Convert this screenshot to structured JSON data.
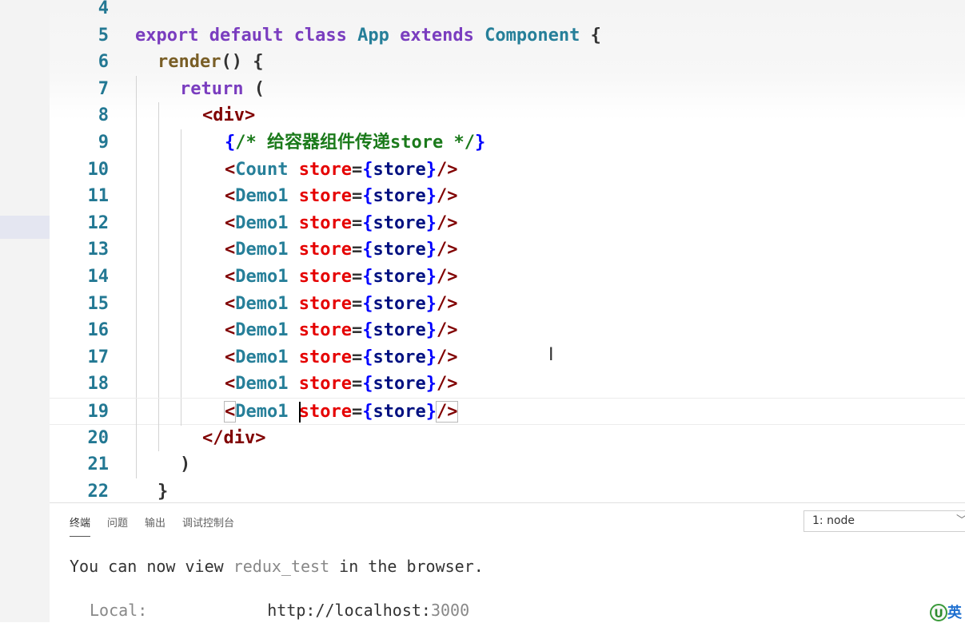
{
  "editor": {
    "lines": [
      {
        "n": "4",
        "tokens": []
      },
      {
        "n": "5",
        "tokens": [
          [
            "kw",
            "export "
          ],
          [
            "kw",
            "default "
          ],
          [
            "kw",
            "class "
          ],
          [
            "ty",
            "App "
          ],
          [
            "kw",
            "extends "
          ],
          [
            "ty",
            "Component "
          ],
          [
            "pl",
            "{"
          ]
        ]
      },
      {
        "n": "6",
        "tokens": [
          [
            "fn",
            "render"
          ],
          [
            "pl",
            "() {"
          ]
        ]
      },
      {
        "n": "7",
        "tokens": [
          [
            "kw",
            "return "
          ],
          [
            "pl",
            "("
          ]
        ]
      },
      {
        "n": "8",
        "tokens": [
          [
            "tag",
            "<div>"
          ]
        ]
      },
      {
        "n": "9",
        "tokens": [
          [
            "brace",
            "{"
          ],
          [
            "cm",
            "/* 给容器组件传递store */"
          ],
          [
            "brace",
            "}"
          ]
        ]
      },
      {
        "n": "10",
        "tokens": [
          [
            "tag",
            "<"
          ],
          [
            "cmp",
            "Count "
          ],
          [
            "attr",
            "store"
          ],
          [
            "pl",
            "="
          ],
          [
            "brace",
            "{"
          ],
          [
            "var",
            "store"
          ],
          [
            "brace",
            "}"
          ],
          [
            "tag",
            "/>"
          ]
        ]
      },
      {
        "n": "11",
        "tokens": [
          [
            "tag",
            "<"
          ],
          [
            "cmp",
            "Demo1 "
          ],
          [
            "attr",
            "store"
          ],
          [
            "pl",
            "="
          ],
          [
            "brace",
            "{"
          ],
          [
            "var",
            "store"
          ],
          [
            "brace",
            "}"
          ],
          [
            "tag",
            "/>"
          ]
        ]
      },
      {
        "n": "12",
        "tokens": [
          [
            "tag",
            "<"
          ],
          [
            "cmp",
            "Demo1 "
          ],
          [
            "attr",
            "store"
          ],
          [
            "pl",
            "="
          ],
          [
            "brace",
            "{"
          ],
          [
            "var",
            "store"
          ],
          [
            "brace",
            "}"
          ],
          [
            "tag",
            "/>"
          ]
        ]
      },
      {
        "n": "13",
        "tokens": [
          [
            "tag",
            "<"
          ],
          [
            "cmp",
            "Demo1 "
          ],
          [
            "attr",
            "store"
          ],
          [
            "pl",
            "="
          ],
          [
            "brace",
            "{"
          ],
          [
            "var",
            "store"
          ],
          [
            "brace",
            "}"
          ],
          [
            "tag",
            "/>"
          ]
        ]
      },
      {
        "n": "14",
        "tokens": [
          [
            "tag",
            "<"
          ],
          [
            "cmp",
            "Demo1 "
          ],
          [
            "attr",
            "store"
          ],
          [
            "pl",
            "="
          ],
          [
            "brace",
            "{"
          ],
          [
            "var",
            "store"
          ],
          [
            "brace",
            "}"
          ],
          [
            "tag",
            "/>"
          ]
        ]
      },
      {
        "n": "15",
        "tokens": [
          [
            "tag",
            "<"
          ],
          [
            "cmp",
            "Demo1 "
          ],
          [
            "attr",
            "store"
          ],
          [
            "pl",
            "="
          ],
          [
            "brace",
            "{"
          ],
          [
            "var",
            "store"
          ],
          [
            "brace",
            "}"
          ],
          [
            "tag",
            "/>"
          ]
        ]
      },
      {
        "n": "16",
        "tokens": [
          [
            "tag",
            "<"
          ],
          [
            "cmp",
            "Demo1 "
          ],
          [
            "attr",
            "store"
          ],
          [
            "pl",
            "="
          ],
          [
            "brace",
            "{"
          ],
          [
            "var",
            "store"
          ],
          [
            "brace",
            "}"
          ],
          [
            "tag",
            "/>"
          ]
        ]
      },
      {
        "n": "17",
        "tokens": [
          [
            "tag",
            "<"
          ],
          [
            "cmp",
            "Demo1 "
          ],
          [
            "attr",
            "store"
          ],
          [
            "pl",
            "="
          ],
          [
            "brace",
            "{"
          ],
          [
            "var",
            "store"
          ],
          [
            "brace",
            "}"
          ],
          [
            "tag",
            "/>"
          ]
        ]
      },
      {
        "n": "18",
        "tokens": [
          [
            "tag",
            "<"
          ],
          [
            "cmp",
            "Demo1 "
          ],
          [
            "attr",
            "store"
          ],
          [
            "pl",
            "="
          ],
          [
            "brace",
            "{"
          ],
          [
            "var",
            "store"
          ],
          [
            "brace",
            "}"
          ],
          [
            "tag",
            "/>"
          ]
        ]
      },
      {
        "n": "19",
        "tokens": [
          [
            "tag",
            "<"
          ],
          [
            "cmp",
            "Demo1 "
          ],
          [
            "attr",
            "store"
          ],
          [
            "pl",
            "="
          ],
          [
            "brace",
            "{"
          ],
          [
            "var",
            "store"
          ],
          [
            "brace",
            "}"
          ],
          [
            "tag",
            "/>"
          ]
        ]
      },
      {
        "n": "20",
        "tokens": [
          [
            "tag",
            "</div>"
          ]
        ]
      },
      {
        "n": "21",
        "tokens": [
          [
            "pl",
            ")"
          ]
        ]
      },
      {
        "n": "22",
        "tokens": [
          [
            "pl",
            "}"
          ]
        ]
      }
    ]
  },
  "panel": {
    "tabs": [
      "终端",
      "问题",
      "输出",
      "调试控制台"
    ],
    "active_tab": "终端",
    "terminal_select": "1: node",
    "output": {
      "line1_a": "You can now view ",
      "line1_app": "redux_test",
      "line1_b": " in the browser.",
      "local_label": "Local:",
      "local_url_a": "http://localhost:",
      "local_url_port": "3000"
    }
  },
  "taskbar": {
    "ime_icon": "U",
    "ime_text": "英"
  }
}
